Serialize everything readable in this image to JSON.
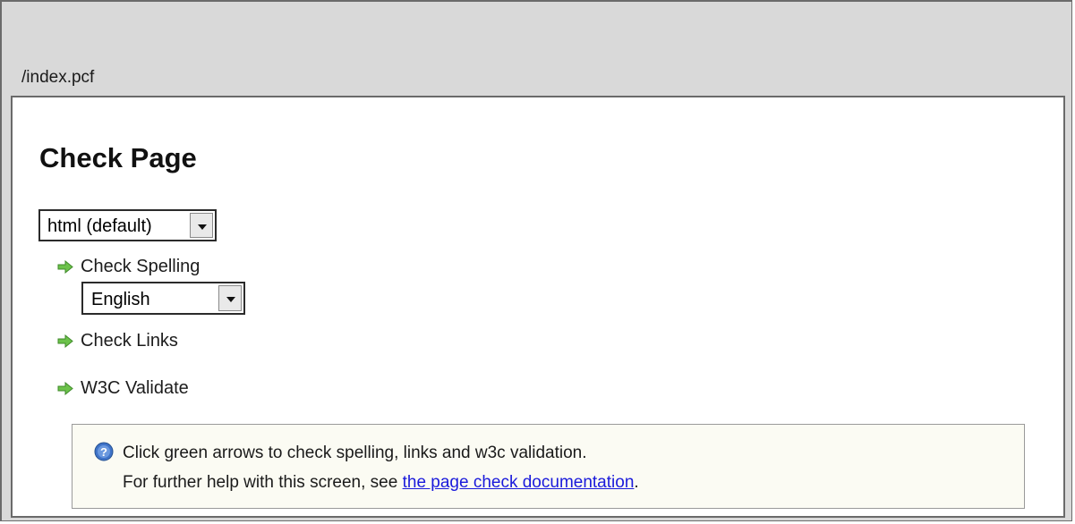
{
  "path": "/index.pcf",
  "title": "Check Page",
  "format_select": {
    "value": "html (default)"
  },
  "actions": {
    "check_spelling": "Check Spelling",
    "language_select": {
      "value": "English"
    },
    "check_links": "Check Links",
    "w3c_validate": "W3C Validate"
  },
  "info": {
    "line1": "Click green arrows to check spelling, links and w3c validation.",
    "line2_prefix": "For further help with this screen, see ",
    "link_text": "the page check documentation",
    "line2_suffix": "."
  },
  "colors": {
    "arrow": "#6cc24a",
    "link": "#1a1adb",
    "info_icon": "#3f73c8"
  },
  "icons": {
    "action": "green-arrow-icon",
    "info": "info-icon",
    "dropdown": "chevron-down-icon"
  }
}
